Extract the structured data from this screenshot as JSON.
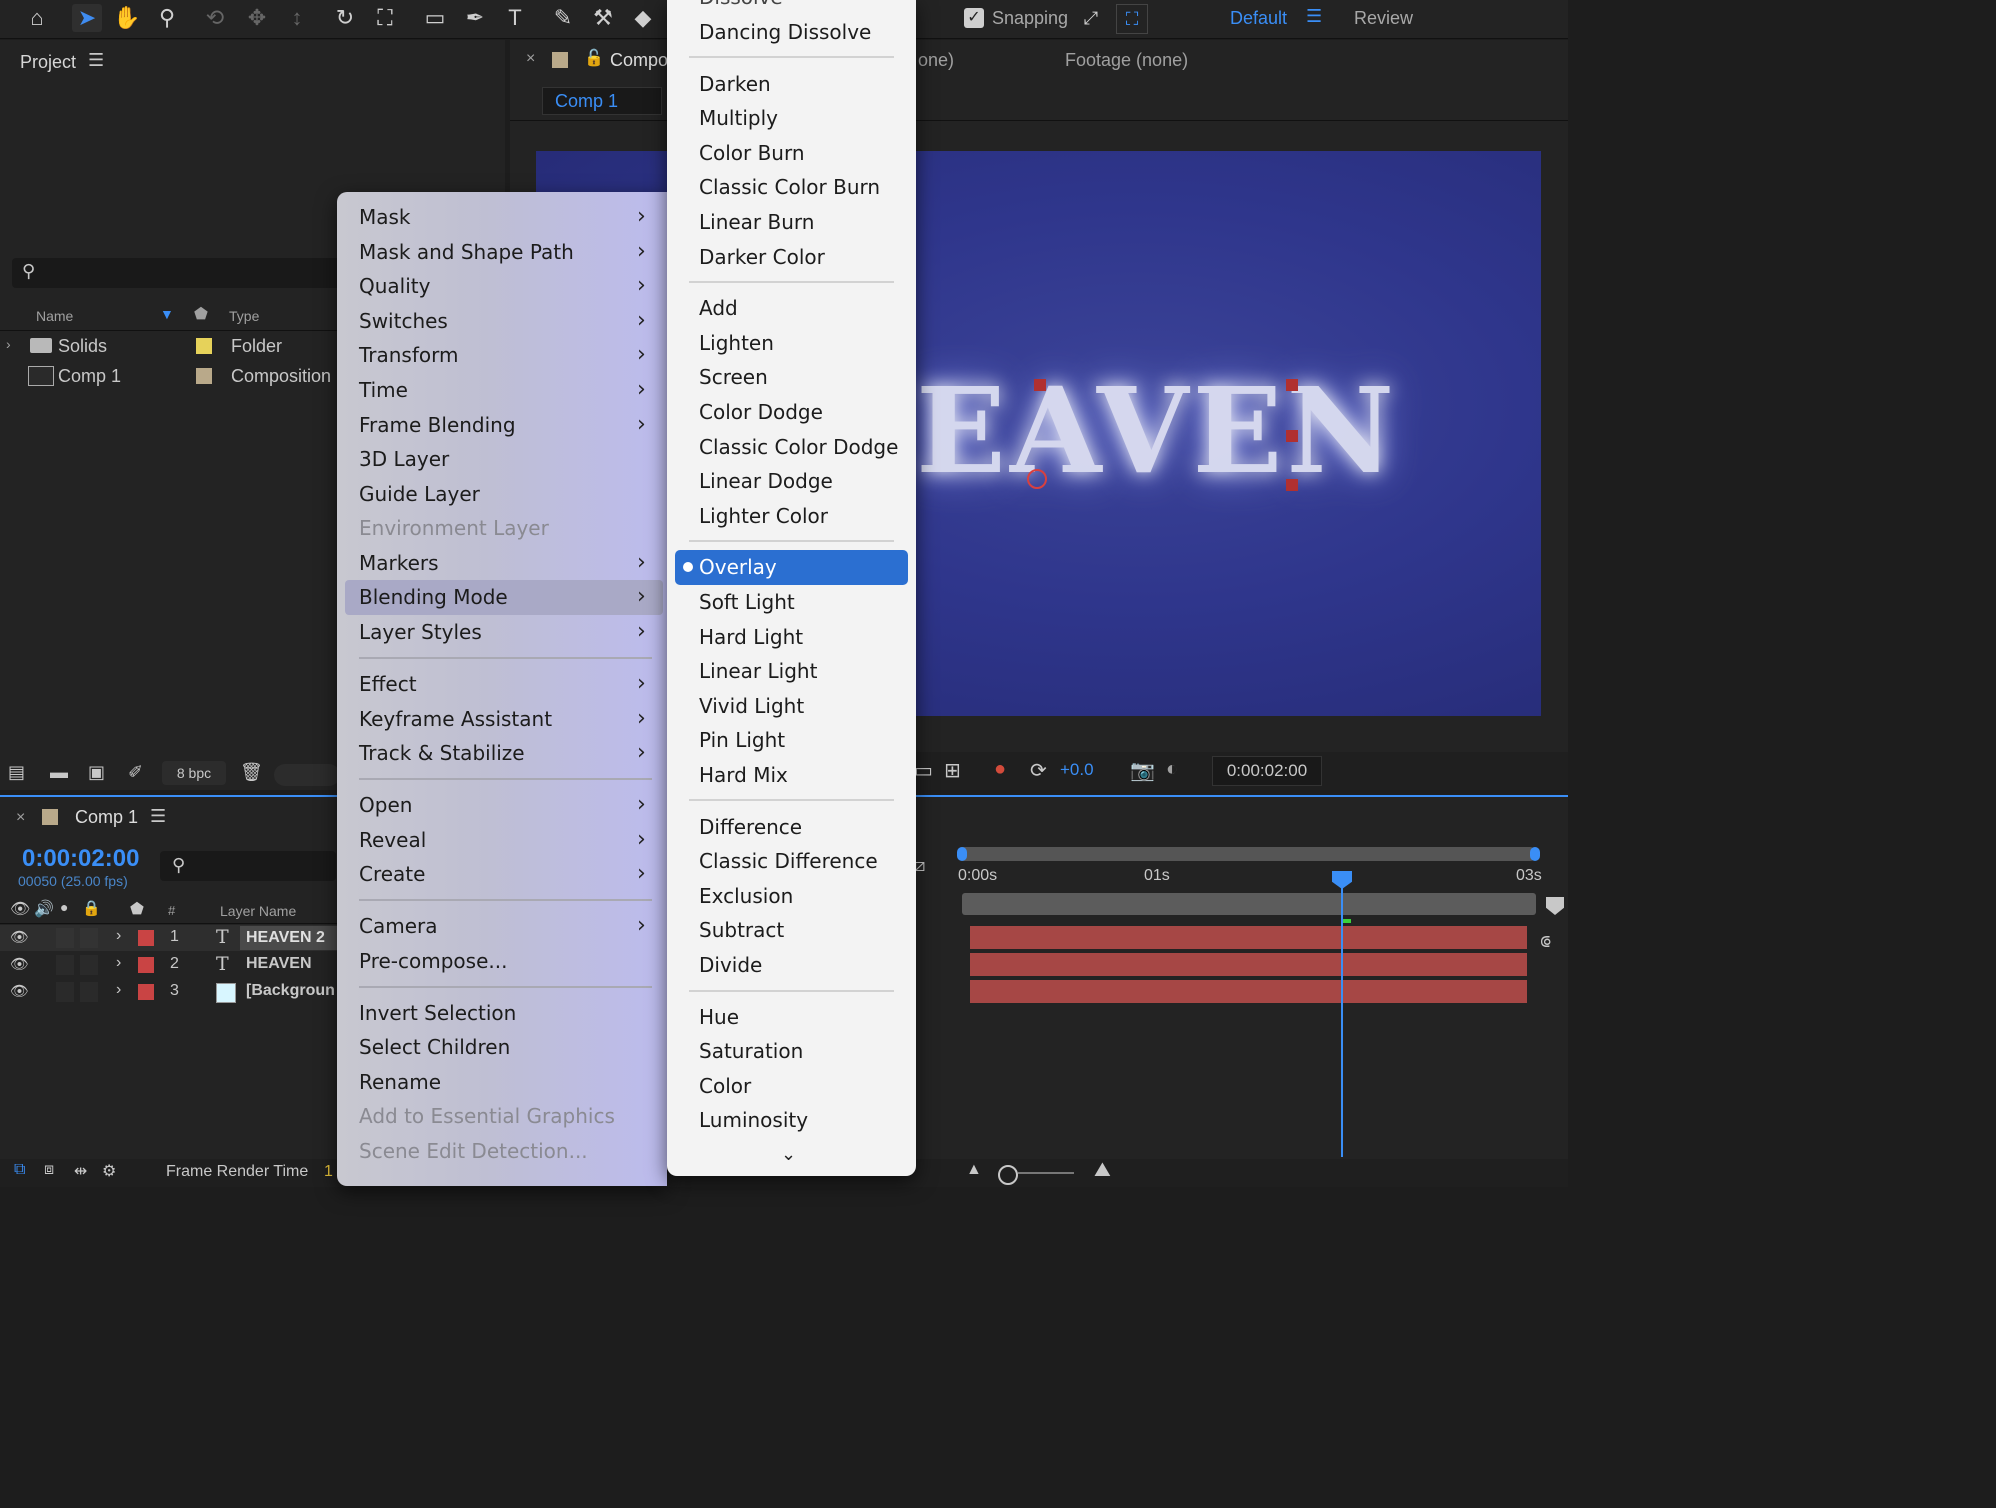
{
  "toolbar": {
    "snapping_label": "Snapping",
    "workspace_default": "Default",
    "workspace_review": "Review"
  },
  "project": {
    "title": "Project",
    "search_placeholder": "",
    "col_name": "Name",
    "col_type": "Type",
    "items": [
      {
        "name": "Solids",
        "type": "Folder",
        "swatch": "#e6d25a"
      },
      {
        "name": "Comp 1",
        "type": "Composition",
        "swatch": "#b9a98a"
      }
    ],
    "bpc": "8 bpc"
  },
  "viewer": {
    "tab_label": "Compo",
    "tab_none": "one)",
    "footage_label": "Footage (none)",
    "breadcrumb": "Comp 1",
    "canvas_text": "EAVEN",
    "exposure": "+0.0",
    "timecode": "0:00:02:00"
  },
  "timeline": {
    "title": "Comp 1",
    "timecode": "0:00:02:00",
    "frame_info": "00050 (25.00 fps)",
    "col_hash": "#",
    "col_layer_name": "Layer Name",
    "layers": [
      {
        "num": "1",
        "type_icon": "T",
        "name": "HEAVEN 2",
        "color": "#c94444"
      },
      {
        "num": "2",
        "type_icon": "T",
        "name": "HEAVEN",
        "color": "#c94444"
      },
      {
        "num": "3",
        "type_icon": "",
        "name": "[Backgroun",
        "color": "#c94444"
      }
    ],
    "ruler": [
      "0:00s",
      "01s",
      "03s"
    ],
    "frame_render_label": "Frame Render Time",
    "frame_render_value": "1"
  },
  "context_menu": {
    "items": [
      {
        "label": "Mask",
        "submenu": true
      },
      {
        "label": "Mask and Shape Path",
        "submenu": true
      },
      {
        "label": "Quality",
        "submenu": true
      },
      {
        "label": "Switches",
        "submenu": true
      },
      {
        "label": "Transform",
        "submenu": true
      },
      {
        "label": "Time",
        "submenu": true
      },
      {
        "label": "Frame Blending",
        "submenu": true
      },
      {
        "label": "3D Layer",
        "submenu": false
      },
      {
        "label": "Guide Layer",
        "submenu": false
      },
      {
        "label": "Environment Layer",
        "submenu": false,
        "disabled": true
      },
      {
        "label": "Markers",
        "submenu": true
      },
      {
        "label": "Blending Mode",
        "submenu": true,
        "highlighted": true
      },
      {
        "label": "Layer Styles",
        "submenu": true
      },
      {
        "label": "Effect",
        "submenu": true
      },
      {
        "label": "Keyframe Assistant",
        "submenu": true
      },
      {
        "label": "Track & Stabilize",
        "submenu": true
      },
      {
        "label": "Open",
        "submenu": true
      },
      {
        "label": "Reveal",
        "submenu": true
      },
      {
        "label": "Create",
        "submenu": true
      },
      {
        "label": "Camera",
        "submenu": true
      },
      {
        "label": "Pre-compose...",
        "submenu": false
      },
      {
        "label": "Invert Selection",
        "submenu": false
      },
      {
        "label": "Select Children",
        "submenu": false
      },
      {
        "label": "Rename",
        "submenu": false
      },
      {
        "label": "Add to Essential Graphics",
        "submenu": false,
        "disabled": true
      },
      {
        "label": "Scene Edit Detection...",
        "submenu": false,
        "disabled": true
      }
    ]
  },
  "blend_menu": {
    "items": [
      "Dissolve",
      "Dancing Dissolve",
      "Darken",
      "Multiply",
      "Color Burn",
      "Classic Color Burn",
      "Linear Burn",
      "Darker Color",
      "Add",
      "Lighten",
      "Screen",
      "Color Dodge",
      "Classic Color Dodge",
      "Linear Dodge",
      "Lighter Color",
      "Overlay",
      "Soft Light",
      "Hard Light",
      "Linear Light",
      "Vivid Light",
      "Pin Light",
      "Hard Mix",
      "Difference",
      "Classic Difference",
      "Exclusion",
      "Subtract",
      "Divide",
      "Hue",
      "Saturation",
      "Color",
      "Luminosity"
    ],
    "selected": "Overlay"
  }
}
